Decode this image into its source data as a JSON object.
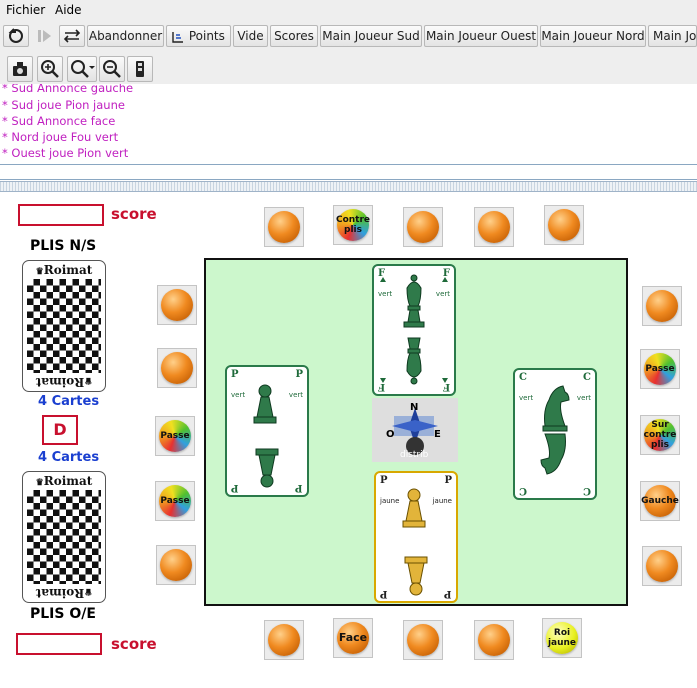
{
  "menu": {
    "fichier": "Fichier",
    "aide": "Aide"
  },
  "toolbar": {
    "abandonner": "Abandonner",
    "points": "Points",
    "vide": "Vide",
    "scores": "Scores",
    "main_sud": "Main Joueur Sud",
    "main_ouest": "Main Joueur Ouest",
    "main_nord": "Main Joueur Nord",
    "main_est": "Main Jo"
  },
  "log": [
    "* Sud Annonce gauche",
    "* Sud joue Pion jaune",
    "* Sud Annonce face",
    "* Nord joue Fou vert",
    "* Ouest joue Pion vert"
  ],
  "left_panel": {
    "score_label_top": "score",
    "plis_ns": "PLIS N/S",
    "deck_brand": "Roimat",
    "cartes_top": "4 Cartes",
    "dealer": "D",
    "cartes_bottom": "4 Cartes",
    "plis_oe": "PLIS O/E",
    "score_label_bottom": "score"
  },
  "bids": {
    "top_2": "Contre plis",
    "right_2": "Passe",
    "right_3": "Sur contre plis",
    "right_4": "Gauche",
    "left_3": "Passe",
    "left_4": "Passe",
    "bottom_2": "Face",
    "bottom_5": "Roi jaune"
  },
  "cards": {
    "north": {
      "rank": "F",
      "color": "vert"
    },
    "west": {
      "rank": "P",
      "color": "vert"
    },
    "east": {
      "rank": "C",
      "color": "vert"
    },
    "south": {
      "rank": "P",
      "color": "jaune"
    }
  },
  "compass": {
    "n": "N",
    "o": "O",
    "e": "E",
    "label": "distrib"
  },
  "colors": {
    "accent_red": "#c8102e",
    "cartes_blue": "#1a3fd0",
    "log_magenta": "#c020c0",
    "board_green": "#ccf7cc"
  }
}
